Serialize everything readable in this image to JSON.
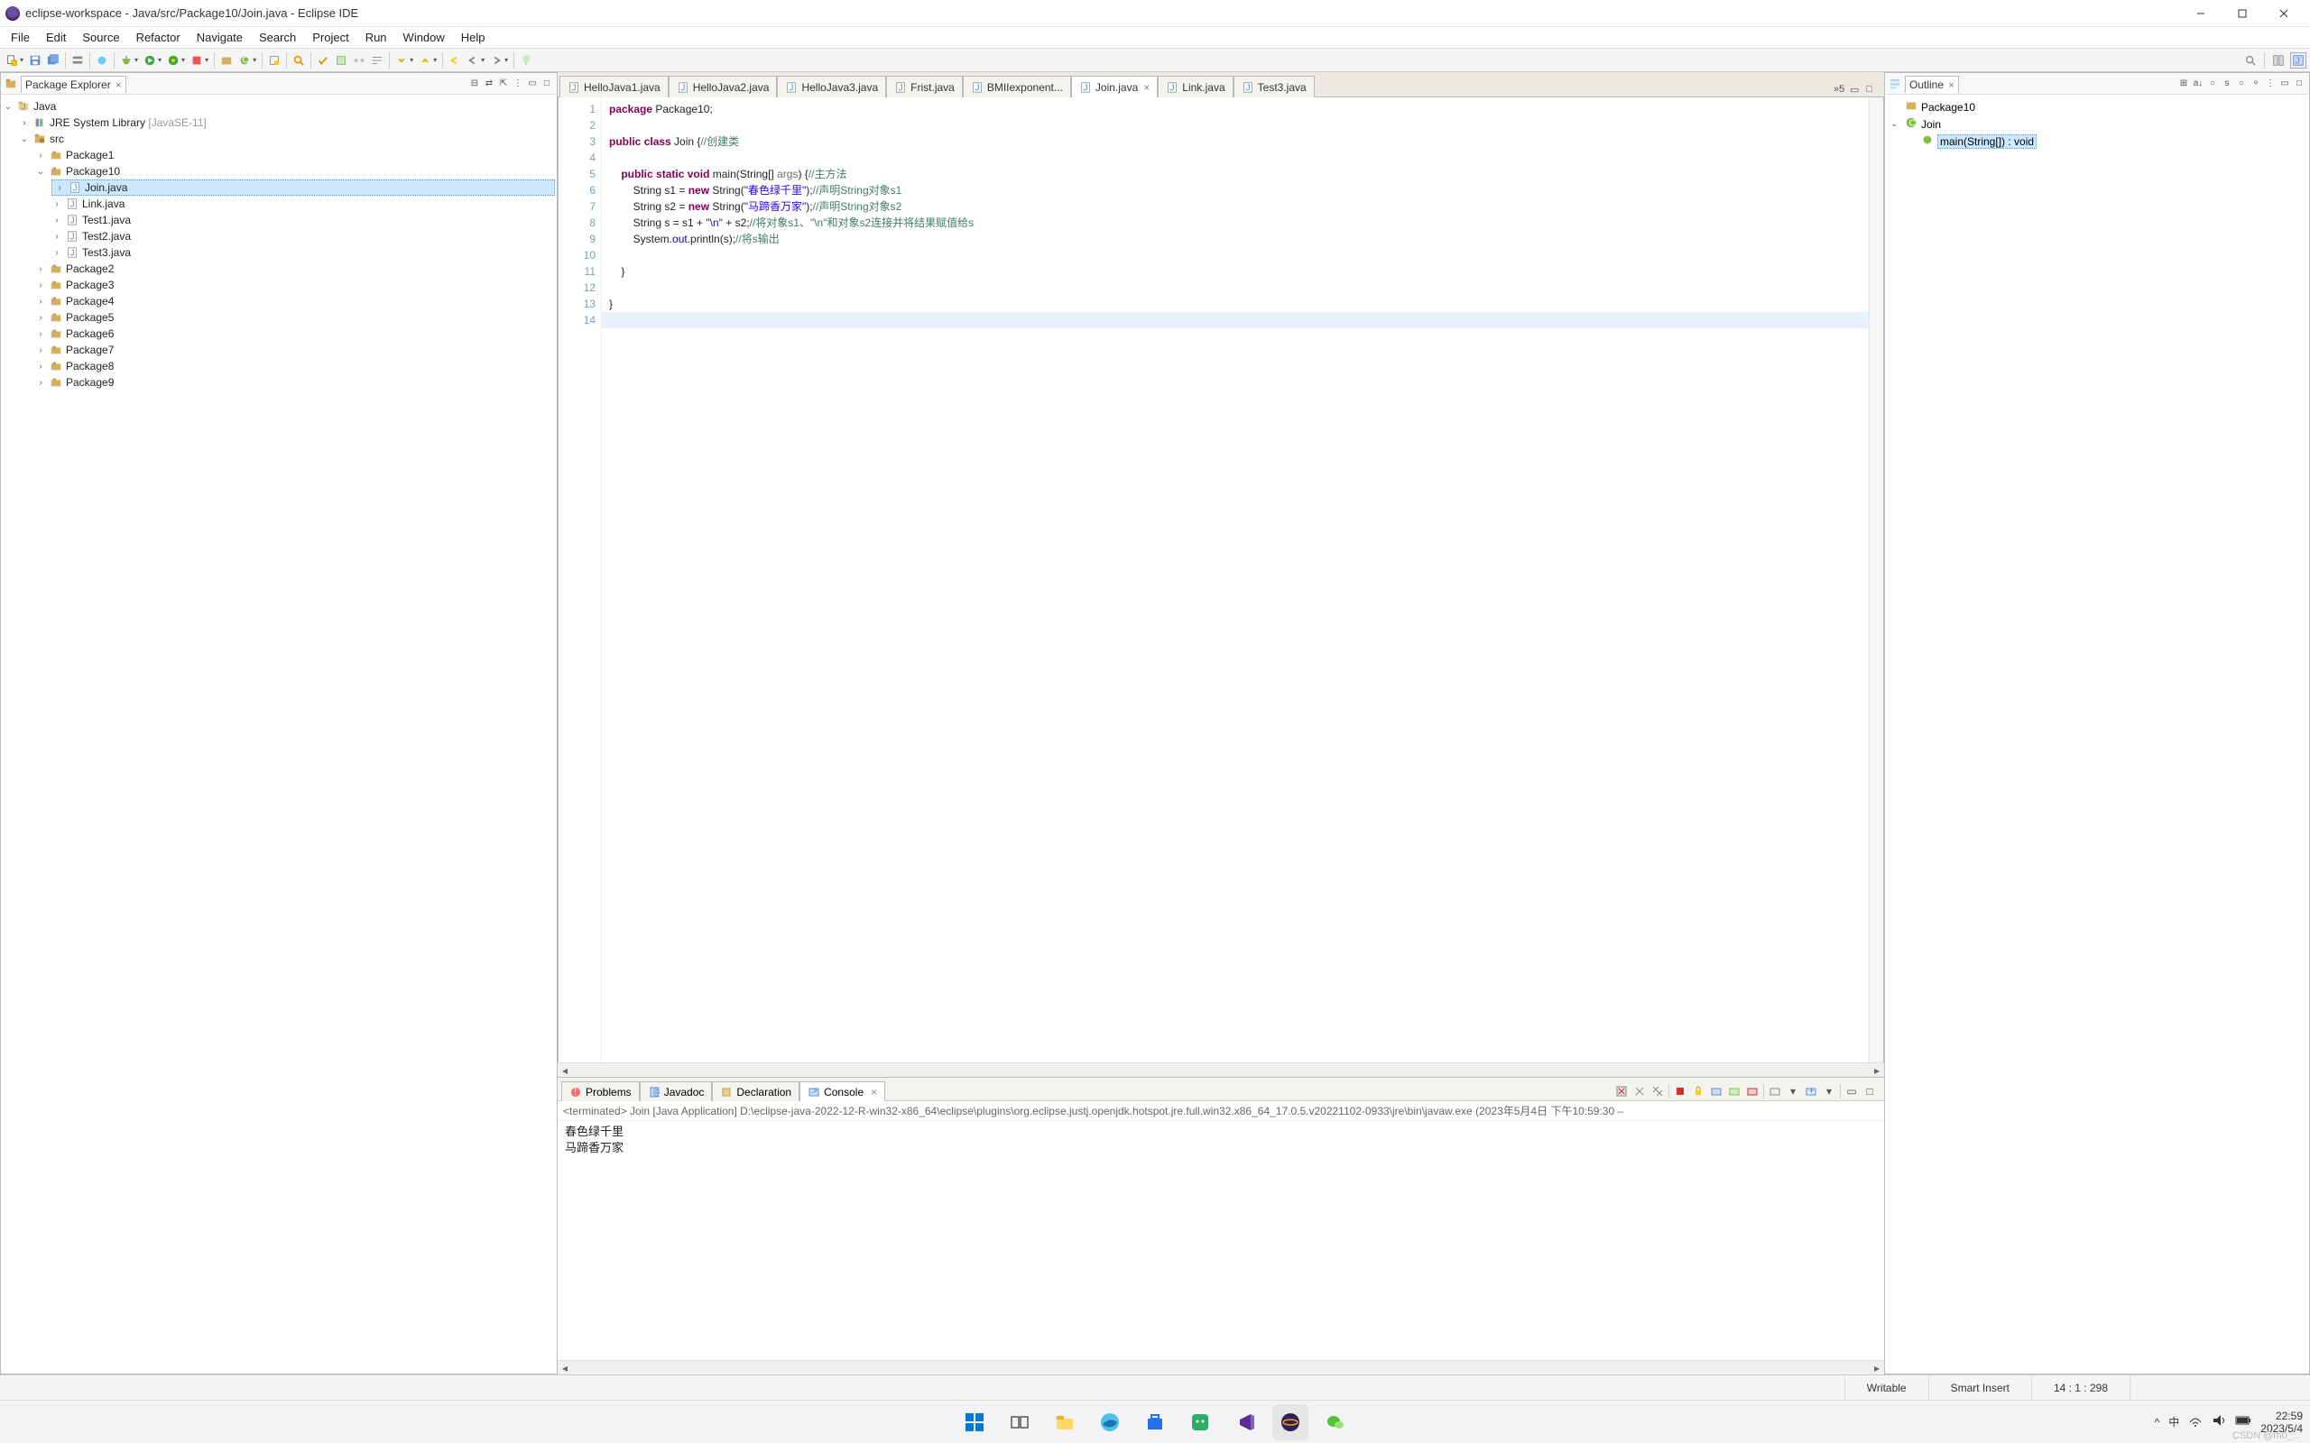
{
  "window": {
    "title": "eclipse-workspace - Java/src/Package10/Join.java - Eclipse IDE"
  },
  "menu": [
    "File",
    "Edit",
    "Source",
    "Refactor",
    "Navigate",
    "Search",
    "Project",
    "Run",
    "Window",
    "Help"
  ],
  "package_explorer": {
    "title": "Package Explorer",
    "project": "Java",
    "jre": "JRE System Library",
    "jre_extra": "[JavaSE-11]",
    "src": "src",
    "packages": [
      "Package1",
      "Package10",
      "Package2",
      "Package3",
      "Package4",
      "Package5",
      "Package6",
      "Package7",
      "Package8",
      "Package9"
    ],
    "package10_files": [
      "Join.java",
      "Link.java",
      "Test1.java",
      "Test2.java",
      "Test3.java"
    ],
    "selected": "Join.java"
  },
  "editor_tabs": [
    {
      "label": "HelloJava1.java",
      "active": false,
      "closable": false
    },
    {
      "label": "HelloJava2.java",
      "active": false,
      "closable": false
    },
    {
      "label": "HelloJava3.java",
      "active": false,
      "closable": false
    },
    {
      "label": "Frist.java",
      "active": false,
      "closable": false
    },
    {
      "label": "BMIIexponent...",
      "active": false,
      "closable": false
    },
    {
      "label": "Join.java",
      "active": true,
      "closable": true
    },
    {
      "label": "Link.java",
      "active": false,
      "closable": false
    },
    {
      "label": "Test3.java",
      "active": false,
      "closable": false
    }
  ],
  "editor_overflow": "»5",
  "code": {
    "lines": [
      {
        "n": "1",
        "html": "<span class='kw'>package</span> Package10;"
      },
      {
        "n": "2",
        "html": ""
      },
      {
        "n": "3",
        "html": "<span class='kw'>public</span> <span class='kw'>class</span> Join {<span class='cm'>//创建类</span>"
      },
      {
        "n": "4",
        "html": ""
      },
      {
        "n": "5",
        "html": "    <span class='kw'>public</span> <span class='kw'>static</span> <span class='kw'>void</span> main(String[] <span class='args'>args</span>) {<span class='cm'>//主方法</span>",
        "marker": "⊖"
      },
      {
        "n": "6",
        "html": "        String s1 = <span class='kw'>new</span> String(<span class='str'>\"春色绿千里\"</span>);<span class='cm'>//声明String对象s1</span>"
      },
      {
        "n": "7",
        "html": "        String s2 = <span class='kw'>new</span> String(<span class='str'>\"马蹄香万家\"</span>);<span class='cm'>//声明String对象s2</span>"
      },
      {
        "n": "8",
        "html": "        String s = s1 + <span class='str'>\"\\n\"</span> + s2;<span class='cm'>//将对象s1、\"\\n\"和对象s2连接并将结果赋值给s</span>"
      },
      {
        "n": "9",
        "html": "        System.<span class='fld'>out</span>.println(s);<span class='cm'>//将s输出</span>"
      },
      {
        "n": "10",
        "html": ""
      },
      {
        "n": "11",
        "html": "    }"
      },
      {
        "n": "12",
        "html": ""
      },
      {
        "n": "13",
        "html": "}"
      },
      {
        "n": "14",
        "html": "",
        "current": true
      }
    ]
  },
  "outline": {
    "title": "Outline",
    "package": "Package10",
    "class": "Join",
    "method": "main(String[]) : void"
  },
  "bottom_tabs": [
    {
      "label": "Problems",
      "icon": "problems-icon"
    },
    {
      "label": "Javadoc",
      "icon": "javadoc-icon"
    },
    {
      "label": "Declaration",
      "icon": "declaration-icon"
    },
    {
      "label": "Console",
      "icon": "console-icon",
      "active": true,
      "closable": true
    }
  ],
  "console": {
    "header": "<terminated> Join [Java Application] D:\\eclipse-java-2022-12-R-win32-x86_64\\eclipse\\plugins\\org.eclipse.justj.openjdk.hotspot.jre.full.win32.x86_64_17.0.5.v20221102-0933\\jre\\bin\\javaw.exe  (2023年5月4日 下午10:59:30 –",
    "output": "春色绿千里\n马蹄香万家"
  },
  "status": {
    "writable": "Writable",
    "insert": "Smart Insert",
    "pos": "14 : 1 : 298"
  },
  "tray": {
    "ime": "中",
    "time": "22:59",
    "date": "2023/5/4",
    "watermark": "CSDN @m0_..."
  }
}
